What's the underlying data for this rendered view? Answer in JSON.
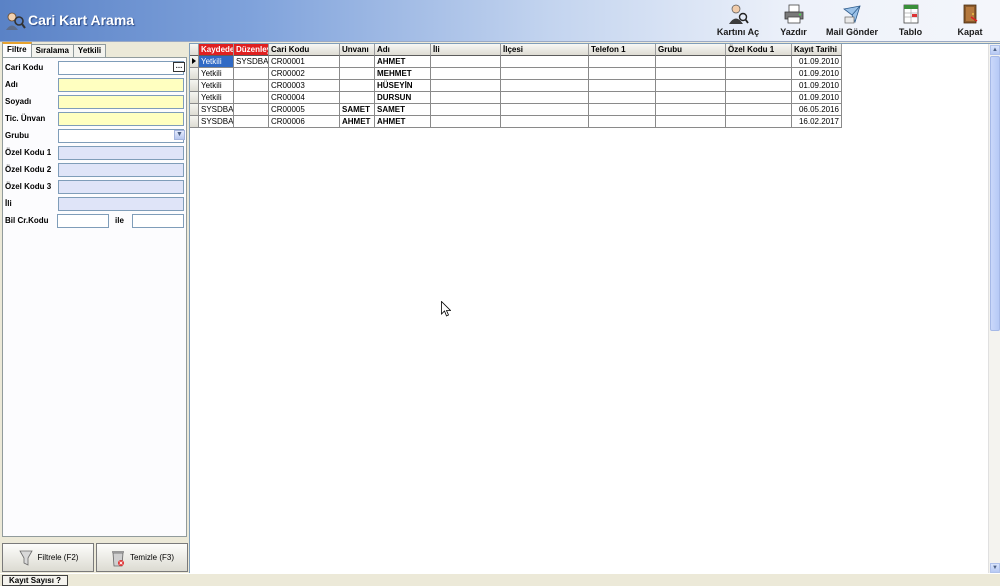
{
  "app": {
    "title": "Cari Kart Arama",
    "icon": "users-search-icon"
  },
  "toolbar": [
    {
      "id": "kartini-ac",
      "label": "Kartını Aç",
      "icon": "card-open-icon"
    },
    {
      "id": "yazdir",
      "label": "Yazdır",
      "icon": "printer-icon"
    },
    {
      "id": "mail-gonder",
      "label": "Mail Gönder",
      "icon": "mail-icon"
    },
    {
      "id": "tablo",
      "label": "Tablo",
      "icon": "table-icon"
    },
    {
      "id": "kapat",
      "label": "Kapat",
      "icon": "exit-door-icon"
    }
  ],
  "left_tabs": [
    {
      "label": "Filtre",
      "active": true
    },
    {
      "label": "Sıralama",
      "active": false
    },
    {
      "label": "Yetkili",
      "active": false
    }
  ],
  "filters": {
    "cari_kodu": {
      "label": "Cari Kodu",
      "value": ""
    },
    "adi": {
      "label": "Adı",
      "value": ""
    },
    "soyadi": {
      "label": "Soyadı",
      "value": ""
    },
    "tic_unvan": {
      "label": "Tic. Ünvan",
      "value": ""
    },
    "grubu": {
      "label": "Grubu",
      "value": ""
    },
    "ozel_kodu_1": {
      "label": "Özel Kodu 1",
      "value": ""
    },
    "ozel_kodu_2": {
      "label": "Özel Kodu 2",
      "value": ""
    },
    "ozel_kodu_3": {
      "label": "Özel Kodu 3",
      "value": ""
    },
    "ili": {
      "label": "İli",
      "value": ""
    },
    "bil_cr_kodu": {
      "label": "Bil Cr.Kodu",
      "from": "",
      "to": "",
      "between_label": "ile"
    }
  },
  "buttons": {
    "filtrele": "Filtrele (F2)",
    "temizle": "Temizle (F3)"
  },
  "grid": {
    "columns": [
      "Kaydeden",
      "Düzenleyen",
      "Cari Kodu",
      "Unvanı",
      "Adı",
      "İli",
      "İlçesi",
      "Telefon 1",
      "Grubu",
      "Özel Kodu 1",
      "Kayıt Tarihi"
    ],
    "rows": [
      [
        "Yetkili",
        "SYSDBA",
        "CR00001",
        "",
        "AHMET",
        "",
        "",
        "",
        "",
        "",
        "01.09.2010"
      ],
      [
        "Yetkili",
        "",
        "CR00002",
        "",
        "MEHMET",
        "",
        "",
        "",
        "",
        "",
        "01.09.2010"
      ],
      [
        "Yetkili",
        "",
        "CR00003",
        "",
        "HÜSEYİN",
        "",
        "",
        "",
        "",
        "",
        "01.09.2010"
      ],
      [
        "Yetkili",
        "",
        "CR00004",
        "",
        "DURSUN",
        "",
        "",
        "",
        "",
        "",
        "01.09.2010"
      ],
      [
        "SYSDBA",
        "",
        "CR00005",
        "SAMET",
        "SAMET",
        "",
        "",
        "",
        "",
        "",
        "06.05.2016"
      ],
      [
        "SYSDBA",
        "",
        "CR00006",
        "AHMET",
        "AHMET",
        "",
        "",
        "",
        "",
        "",
        "16.02.2017"
      ]
    ],
    "selected_row": 0
  },
  "status": {
    "kayit_sayisi": "Kayıt Sayısı ?"
  },
  "colors": {
    "header_red": "#e02020",
    "selection": "#316ac5",
    "input_yellow": "#ffffc0",
    "input_blue": "#dfe4f8"
  }
}
